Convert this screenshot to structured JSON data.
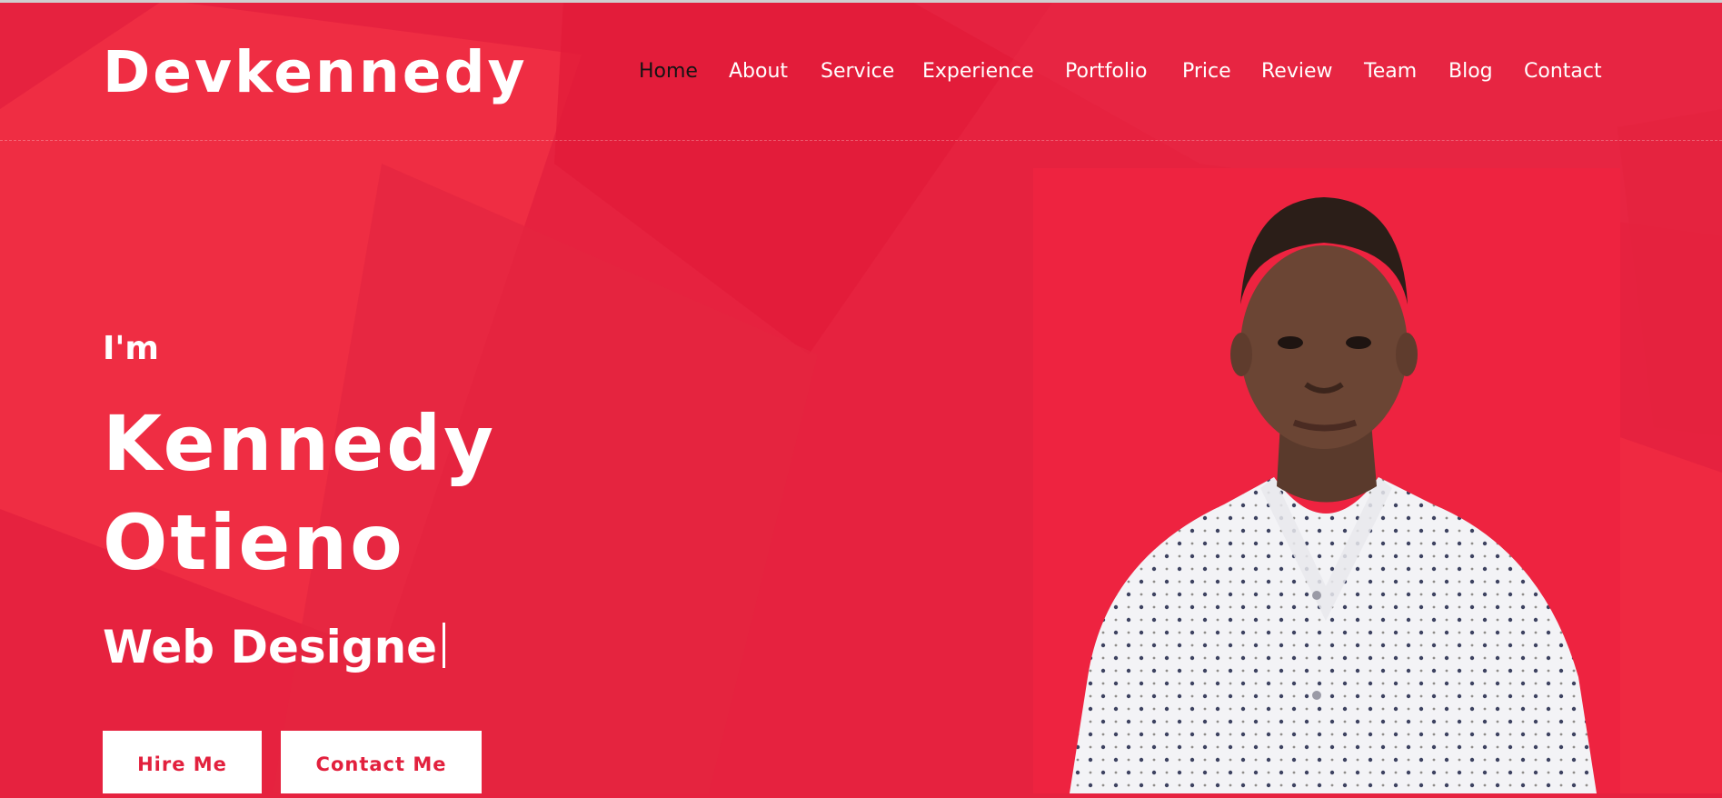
{
  "header": {
    "logo": "Devkennedy",
    "nav": [
      {
        "label": "Home",
        "active": true
      },
      {
        "label": "About",
        "active": false
      },
      {
        "label": "Service",
        "active": false
      },
      {
        "label": "Experience",
        "active": false
      },
      {
        "label": "Portfolio",
        "active": false
      },
      {
        "label": "Price",
        "active": false
      },
      {
        "label": "Review",
        "active": false
      },
      {
        "label": "Team",
        "active": false
      },
      {
        "label": "Blog",
        "active": false
      },
      {
        "label": "Contact",
        "active": false
      }
    ]
  },
  "hero": {
    "intro": "I'm",
    "name_first": "Kennedy",
    "name_last": "Otieno",
    "role": "Web Designe",
    "buttons": {
      "hire": "Hire Me",
      "contact": "Contact Me"
    },
    "photo_icon": "profile-photo"
  },
  "colors": {
    "background": "#e6223f",
    "accent": "#e2203d",
    "photo_background": "#ee2340",
    "text": "#ffffff",
    "active_nav": "#141414"
  }
}
